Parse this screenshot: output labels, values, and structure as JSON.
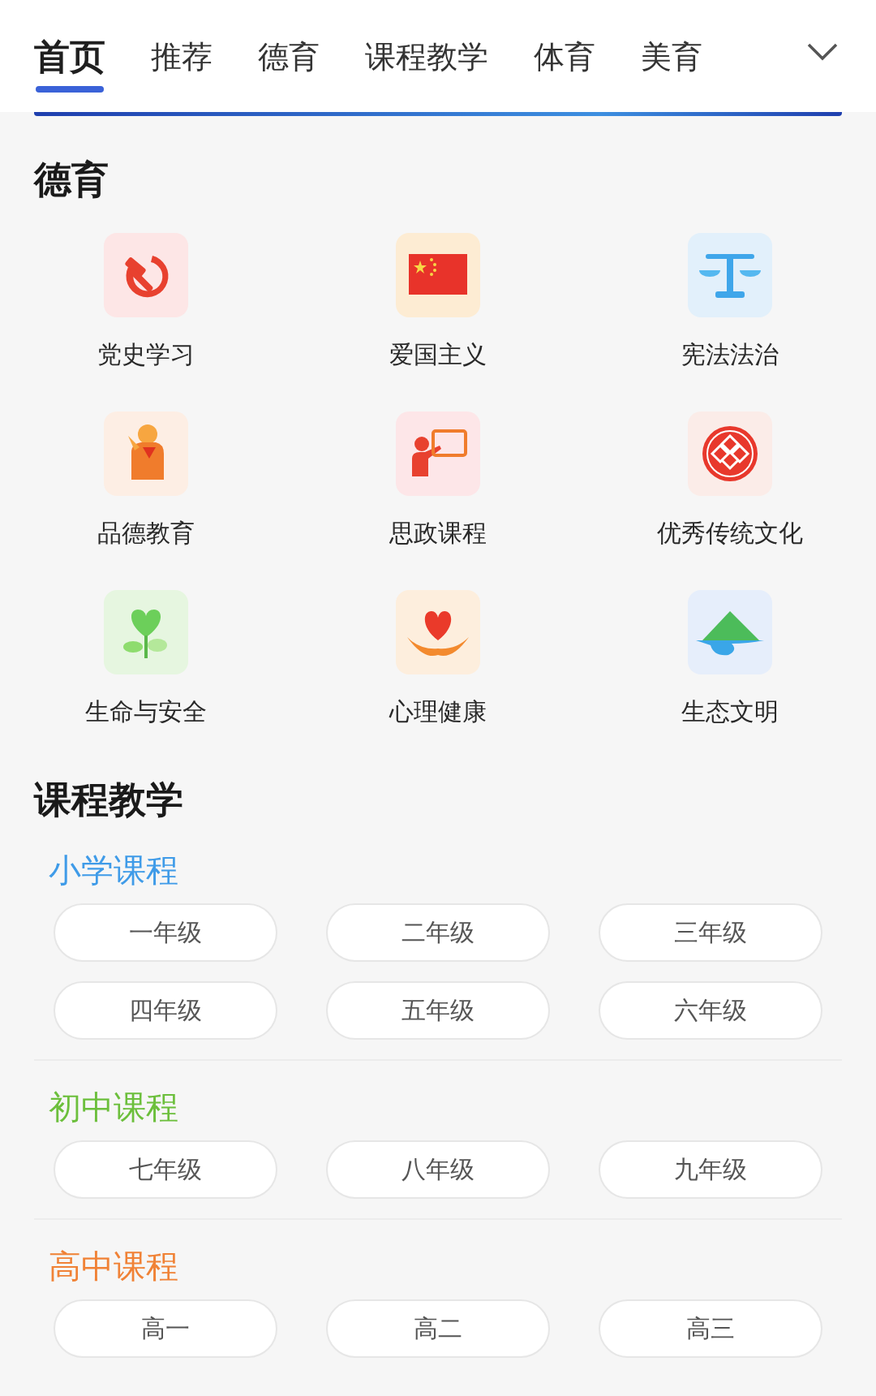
{
  "tabs": [
    {
      "label": "首页",
      "selected": true
    },
    {
      "label": "推荐",
      "selected": false
    },
    {
      "label": "德育",
      "selected": false
    },
    {
      "label": "课程教学",
      "selected": false
    },
    {
      "label": "体育",
      "selected": false
    },
    {
      "label": "美育",
      "selected": false
    }
  ],
  "moral_section": {
    "title": "德育",
    "items": [
      {
        "label": "党史学习"
      },
      {
        "label": "爱国主义"
      },
      {
        "label": "宪法法治"
      },
      {
        "label": "品德教育"
      },
      {
        "label": "思政课程"
      },
      {
        "label": "优秀传统文化"
      },
      {
        "label": "生命与安全"
      },
      {
        "label": "心理健康"
      },
      {
        "label": "生态文明"
      }
    ]
  },
  "course_section": {
    "title": "课程教学",
    "groups": [
      {
        "title": "小学课程",
        "color": "#3f9be8",
        "grades": [
          "一年级",
          "二年级",
          "三年级",
          "四年级",
          "五年级",
          "六年级"
        ]
      },
      {
        "title": "初中课程",
        "color": "#6cbf3c",
        "grades": [
          "七年级",
          "八年级",
          "九年级"
        ]
      },
      {
        "title": "高中课程",
        "color": "#f08236",
        "grades": [
          "高一",
          "高二",
          "高三"
        ]
      }
    ]
  }
}
